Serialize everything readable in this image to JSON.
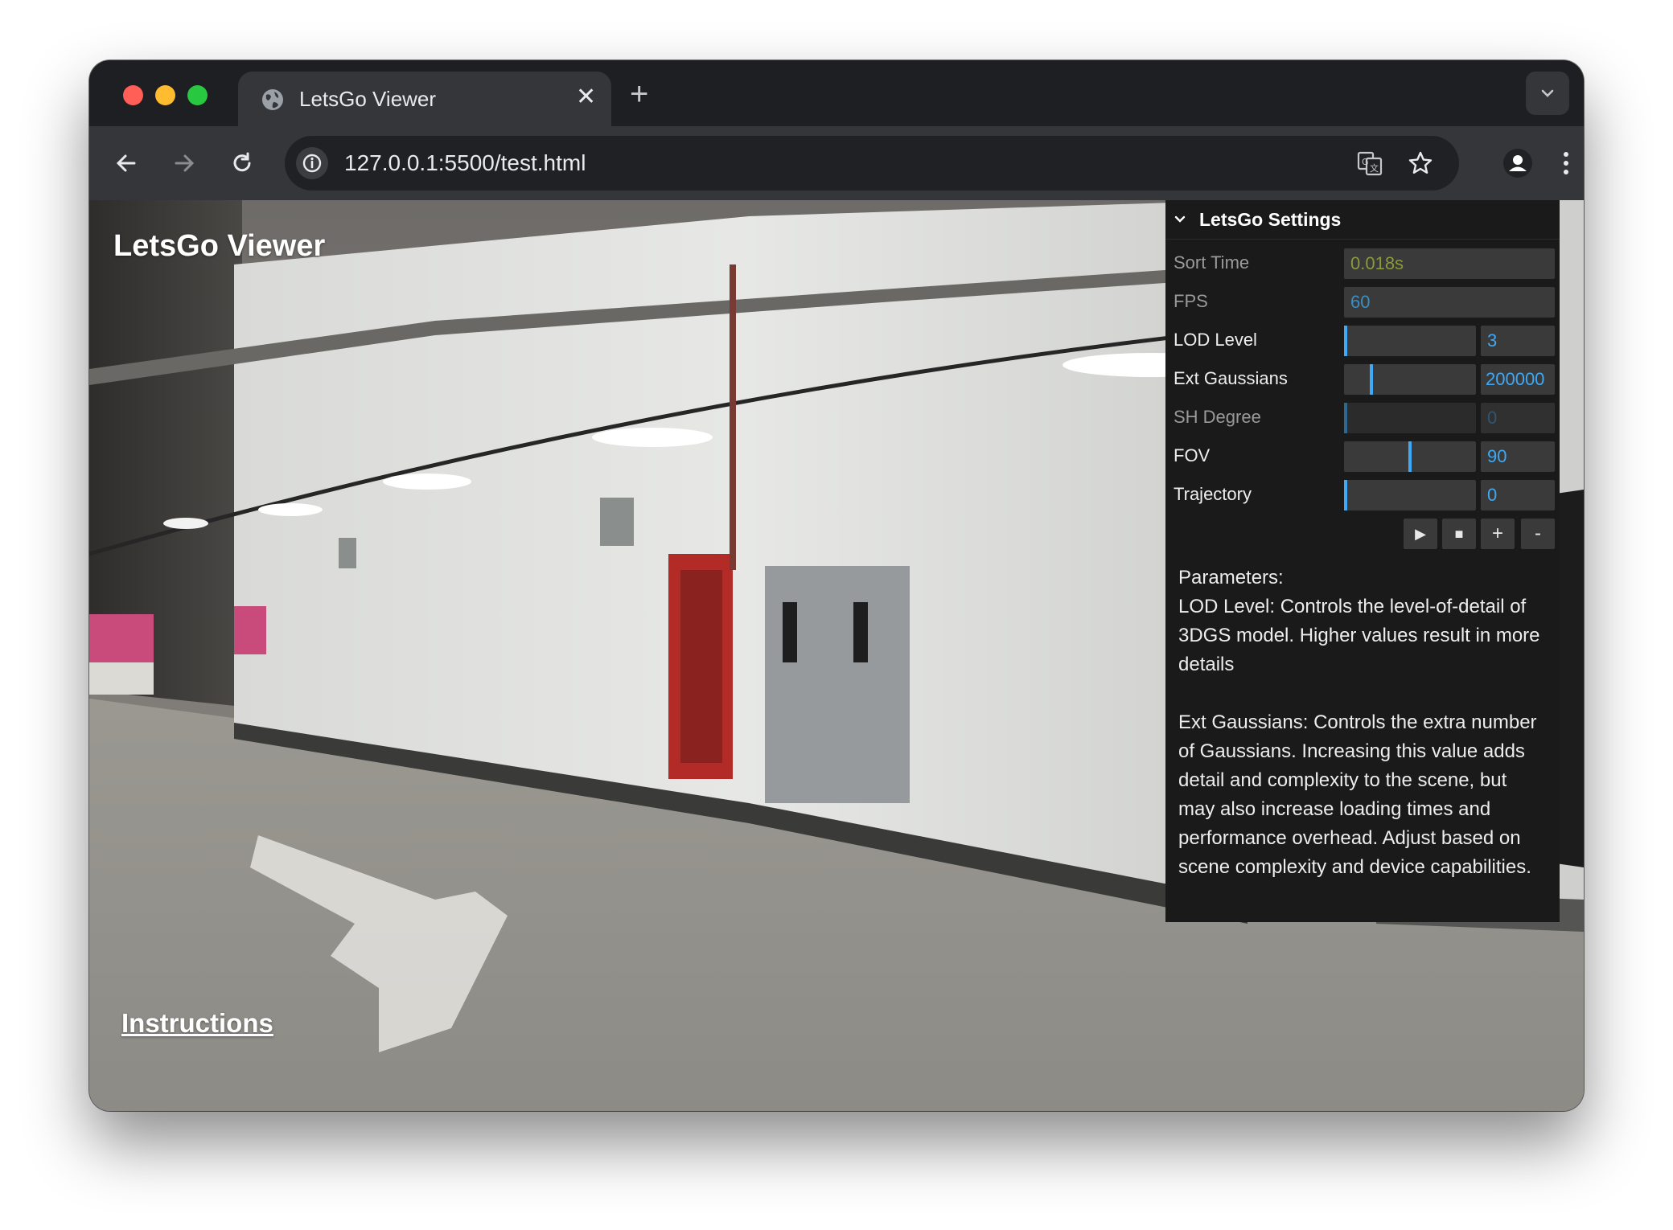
{
  "browser": {
    "tab_title": "LetsGo Viewer",
    "tab_close": "✕",
    "new_tab": "+",
    "url": "127.0.0.1:5500/test.html"
  },
  "app": {
    "title": "LetsGo Viewer",
    "instructions_link": "Instructions"
  },
  "settings": {
    "header": "LetsGo Settings",
    "rows": [
      {
        "label": "Sort Time",
        "value": "0.018s"
      },
      {
        "label": "FPS",
        "value": "60"
      },
      {
        "label": "LOD Level",
        "value": "3",
        "slider_fraction": 0.0
      },
      {
        "label": "Ext Gaussians",
        "value": "200000",
        "slider_fraction": 0.2
      },
      {
        "label": "SH Degree",
        "value": "0",
        "slider_fraction": 0.0
      },
      {
        "label": "FOV",
        "value": "90",
        "slider_fraction": 0.5
      },
      {
        "label": "Trajectory",
        "value": "0",
        "slider_fraction": 0.0
      }
    ],
    "buttons": {
      "play": "▶",
      "stop": "■",
      "add": "+",
      "remove": "-"
    },
    "colors": {
      "sort_time": "#8a9a3a",
      "fps": "#3a8ec2",
      "number": "#3fa9f5",
      "knob": "#3fa9f5"
    }
  },
  "parameters": {
    "heading": "Parameters:",
    "lod_text": "LOD Level: Controls the level-of-detail of 3DGS model. Higher values result in more details",
    "ext_text": "Ext Gaussians: Controls the extra number of Gaussians. Increasing this value adds detail and complexity to the scene, but may also increase loading times and performance overhead. Adjust based on scene complexity and device capabilities."
  }
}
